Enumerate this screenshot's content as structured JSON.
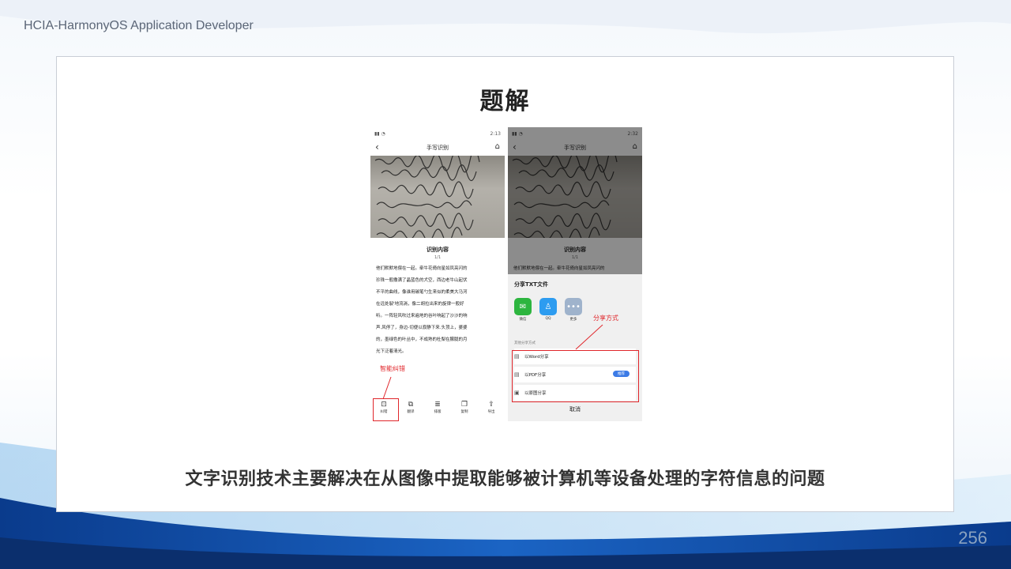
{
  "header": {
    "title": "HCIA-HarmonyOS Application Developer"
  },
  "slide": {
    "title": "题解",
    "caption": "文字识别技术主要解决在从图像中提取能够被计算机等设备处理的字符信息的问题",
    "page_number": "256"
  },
  "left_phone": {
    "status_time": "2:13",
    "nav_title": "手写识别",
    "section_title": "识别内容",
    "page_indicator": "1/1",
    "text_lines": [
      "他们默默地偎在一起。牵牛花倚向星如凤亮闪的",
      "珍珠一般撒满了晶蓝色的犬空，西边老牛山起伏",
      "不平的曲线，像谁用碳笔勺生来似的柔美大马河",
      "在远处裂'地流淌，像二胡拉出来的旋律一般好",
      "听。一阵轻风吹过来遍地的谷叶响起了沙沙的响",
      "声.风停了，身边-切便以寂静下来.头顶上，婆婆",
      "的，墨绿色的叶丛中，不成熟的杜梨在朦胧的月",
      "光下泛着清光。"
    ],
    "annotation": "智能纠错",
    "toolbar": [
      {
        "label": "纠错",
        "icon": "correct-icon"
      },
      {
        "label": "翻译",
        "icon": "translate-icon"
      },
      {
        "label": "排版",
        "icon": "format-icon"
      },
      {
        "label": "复制",
        "icon": "copy-icon"
      },
      {
        "label": "导出",
        "icon": "export-icon"
      }
    ]
  },
  "right_phone": {
    "status_time": "2:32",
    "nav_title": "手写识别",
    "section_title": "识别内容",
    "page_indicator": "1/1",
    "first_line": "他们默默地偎在一起。牵牛花倚向星如凤亮闪的",
    "sheet_title": "分享TXT文件",
    "apps": [
      {
        "label": "微信",
        "color": "#2db53f",
        "icon": "wechat-icon"
      },
      {
        "label": "QQ",
        "color": "#2d9cf0",
        "icon": "qq-icon"
      },
      {
        "label": "更多",
        "color": "#9fb3cc",
        "icon": "more-icon"
      }
    ],
    "annotation": "分享方式",
    "other_label": "其他分享方式",
    "options": [
      {
        "label": "以Word分享",
        "badge": ""
      },
      {
        "label": "以PDF分享",
        "badge": "推荐"
      },
      {
        "label": "以原图分享",
        "badge": ""
      }
    ],
    "cancel": "取消"
  },
  "colors": {
    "accent_red": "#e0262b",
    "accent_blue": "#3c7be6",
    "footer_blue": "#0d3d8a"
  }
}
